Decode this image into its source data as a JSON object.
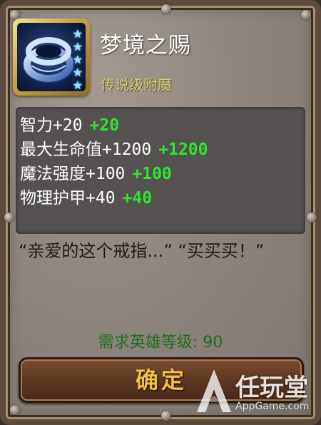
{
  "item": {
    "name": "梦境之赐",
    "rarity": "传说级附魔",
    "stars": 5
  },
  "stats": [
    {
      "label": "智力+20",
      "bonus": "+20"
    },
    {
      "label": "最大生命值+1200",
      "bonus": "+1200"
    },
    {
      "label": "魔法强度+100",
      "bonus": "+100"
    },
    {
      "label": "物理护甲+40",
      "bonus": "+40"
    }
  ],
  "description": "“亲爱的这个戒指...” “买买买！”",
  "requirement": "需求英雄等级: 90",
  "confirm_label": "确定",
  "watermark": {
    "brand": "任玩堂",
    "site": "AppGame.com"
  },
  "colors": {
    "title": "#ffffff",
    "rarity": "#d9cf6f",
    "bonus": "#2ee62e",
    "requirement": "#1f6c1f",
    "button_text": "#f4c03c"
  },
  "icons": {
    "item": "ring-icon",
    "rank": "star-icon"
  }
}
